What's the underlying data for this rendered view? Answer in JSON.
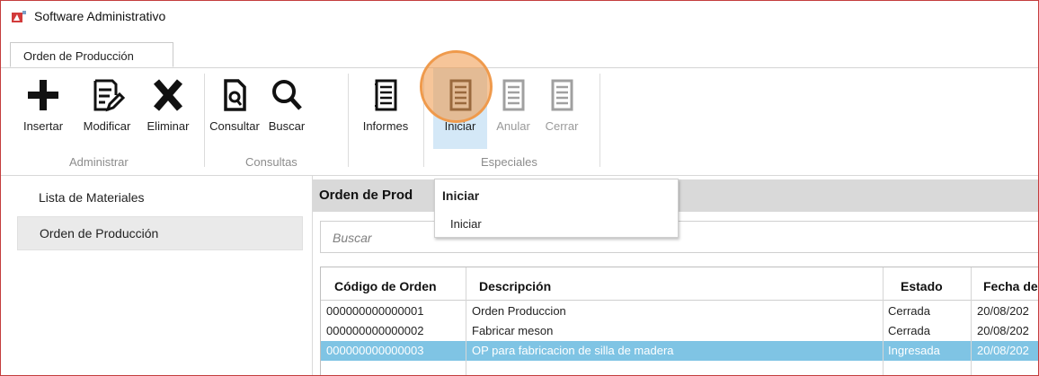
{
  "window": {
    "title": "Software Administrativo",
    "app_icon": "app-logo-icon"
  },
  "tabs": [
    {
      "label": "Orden de Producción"
    }
  ],
  "ribbon": {
    "buttons": [
      {
        "label": "Insertar",
        "icon": "plus-icon"
      },
      {
        "label": "Modificar",
        "icon": "edit-icon"
      },
      {
        "label": "Eliminar",
        "icon": "x-icon"
      },
      {
        "label": "Consultar",
        "icon": "query-document-icon"
      },
      {
        "label": "Buscar",
        "icon": "magnifier-icon"
      },
      {
        "label": "Informes",
        "icon": "report-icon"
      },
      {
        "label": "Iniciar",
        "icon": "start-report-icon"
      },
      {
        "label": "Anular",
        "icon": "cancel-report-icon",
        "disabled": true
      },
      {
        "label": "Cerrar",
        "icon": "close-report-icon",
        "disabled": true
      }
    ],
    "groups": [
      "Administrar",
      "Consultas",
      "Especiales"
    ]
  },
  "tooltip": {
    "title": "Iniciar",
    "text": "Iniciar"
  },
  "sidebar": {
    "items": [
      {
        "label": "Lista de Materiales"
      },
      {
        "label": "Orden de Producción",
        "selected": true
      }
    ]
  },
  "main": {
    "title": "Orden de Prod",
    "search_placeholder": "Buscar"
  },
  "table": {
    "columns": [
      "Código de Orden",
      "Descripción",
      "Estado",
      "Fecha de"
    ],
    "rows": [
      [
        "000000000000001",
        "Orden Produccion",
        "Cerrada",
        "20/08/202"
      ],
      [
        "000000000000002",
        "Fabricar meson",
        "Cerrada",
        "20/08/202"
      ],
      [
        "000000000000003",
        "OP para fabricacion de silla de madera",
        "Ingresada",
        "20/08/202"
      ]
    ],
    "selected_row": 2
  },
  "colors": {
    "selection": "#7fc4e4",
    "highlight": "#ef9a4c",
    "window_border": "#c43d3d"
  }
}
